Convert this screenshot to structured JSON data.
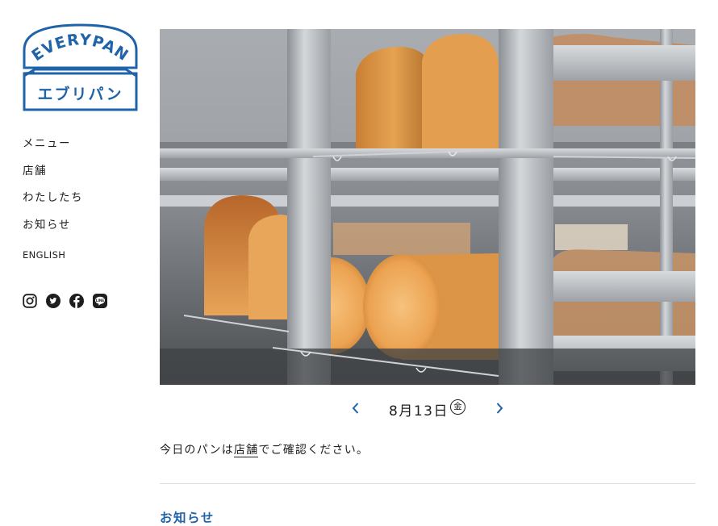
{
  "brand": {
    "logo_text_en": "EVERYPAN",
    "logo_text_ja": "エブリパン",
    "color": "#1f63a8"
  },
  "nav": {
    "items": [
      {
        "label": "メニュー"
      },
      {
        "label": "店舗"
      },
      {
        "label": "わたしたち"
      },
      {
        "label": "お知らせ"
      }
    ],
    "language": "ENGLISH"
  },
  "social": [
    "instagram-icon",
    "twitter-icon",
    "facebook-icon",
    "line-icon"
  ],
  "hero": {
    "image": "bread-loaves-on-bakery-rack-photo"
  },
  "date_nav": {
    "date": "8月13日",
    "weekday": "金",
    "prev_icon": "chevron-left-icon",
    "next_icon": "chevron-right-icon"
  },
  "notice": {
    "before": "今日のパンは",
    "link": "店舗",
    "after": "でご確認ください。"
  },
  "news": {
    "heading": "お知らせ"
  }
}
